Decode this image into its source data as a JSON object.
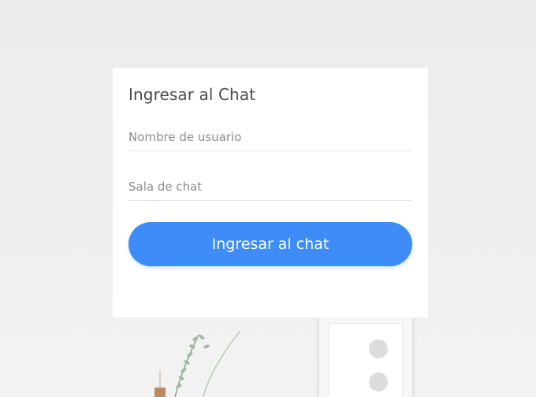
{
  "login": {
    "title": "Ingresar al Chat",
    "username_placeholder": "Nombre de usuario",
    "username_value": "",
    "room_placeholder": "Sala de chat",
    "room_value": "",
    "submit_label": "Ingresar al chat"
  },
  "colors": {
    "accent": "#3d8cf7",
    "card": "#ffffff",
    "background": "#ededed"
  }
}
